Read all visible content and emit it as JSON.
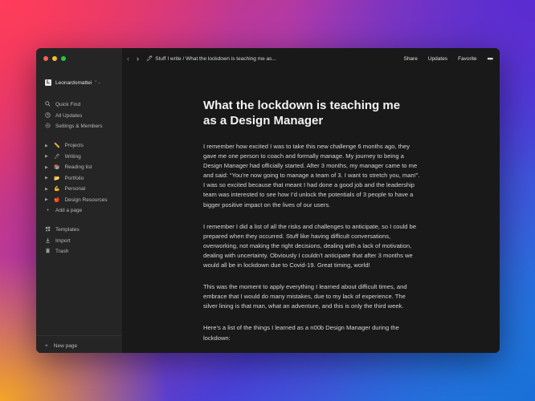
{
  "window": {
    "nav_back": "‹",
    "nav_forward": "›",
    "breadcrumb": "Stuff I write / What the lockdown is teaching me as...",
    "actions": {
      "share": "Share",
      "updates": "Updates",
      "favorite": "Favorite",
      "more": "•••"
    }
  },
  "sidebar": {
    "workspace": "Leonardomattei",
    "workspace_logo": "L",
    "nav": [
      {
        "label": "Quick Find",
        "icon": "search-icon"
      },
      {
        "label": "All Updates",
        "icon": "clock-icon"
      },
      {
        "label": "Settings & Members",
        "icon": "gear-icon"
      }
    ],
    "pages": [
      {
        "label": "Projects",
        "emoji": "✏️"
      },
      {
        "label": "Writing",
        "emoji": "🖊"
      },
      {
        "label": "Reading list",
        "emoji": "📚"
      },
      {
        "label": "Portfolio",
        "emoji": "📂"
      },
      {
        "label": "Personal",
        "emoji": "💪"
      },
      {
        "label": "Design Resources",
        "emoji": "🍎"
      }
    ],
    "add_page": "Add a page",
    "tools": [
      {
        "label": "Templates",
        "icon": "templates-icon"
      },
      {
        "label": "Import",
        "icon": "import-icon"
      },
      {
        "label": "Trash",
        "icon": "trash-icon"
      }
    ],
    "new_page": "New page"
  },
  "document": {
    "title": "What the lockdown is teaching me as a Design Manager",
    "paragraphs": [
      "I remember how excited I was to take this new challenge 6 months ago, they gave me one person to coach and formally manage. My journey to being a Design Manager had officially started. After 3 months, my manager came to me and said: “You’re now going to manage a team of 3. I want to stretch you, man!”. I was so excited because that meant I had done a good job and the leadership team was interested to see how I’d unlock the potentials of 3 people to have a bigger positive impact on the lives of our users.",
      "I remember I did a list of all the risks and challenges to anticipate, so I could be prepared when they occurred. Stuff like having difficult conversations, overworking, not making the right decisions, dealing with a lack of motivation, dealing with uncertainty. Obviously I couldn’t anticipate that after 3 months we would all be in lockdown due to Covid-19. Great timing, world!",
      "This was the moment to apply everything I learned about difficult times, and embrace that I would do many mistakes, due to my lack of experience. The silver lining is that man, what an adventure, and this is only the third week.",
      "Here’s a list of the things I learned as a n00b Design Manager during the lockdown:"
    ]
  }
}
